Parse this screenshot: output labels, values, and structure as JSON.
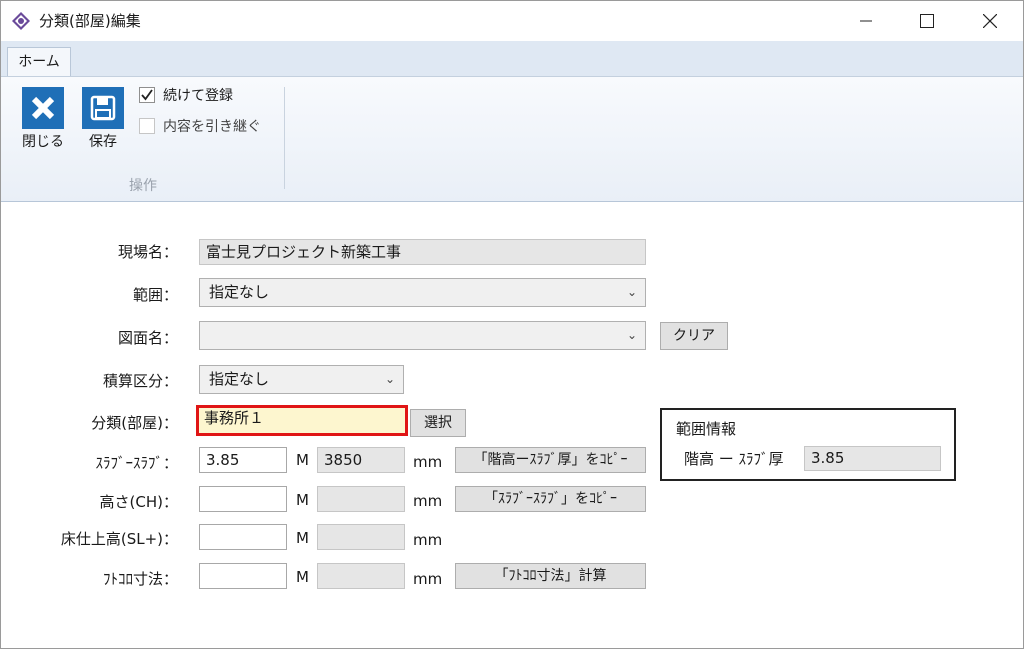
{
  "window": {
    "title": "分類(部屋)編集",
    "app_icon": "app-logo-icon",
    "controls": [
      "minimize-icon",
      "maximize-icon",
      "close-icon"
    ]
  },
  "ribbon": {
    "tabs": [
      {
        "label": "ホーム",
        "active": true
      }
    ],
    "close_label": "閉じる",
    "save_label": "保存",
    "continue_label": "続けて登録",
    "continue_checked": true,
    "inherit_label": "内容を引き継ぐ",
    "inherit_checked": false,
    "group_label": "操作"
  },
  "form": {
    "site_label": "現場名：",
    "site_value": "富士見プロジェクト新築工事",
    "range_label": "範囲：",
    "range_value": "指定なし",
    "drawing_label": "図面名：",
    "drawing_value": "",
    "clear_label": "クリア",
    "estimate_label": "積算区分：",
    "estimate_value": "指定なし",
    "category_label": "分類(部屋)：",
    "category_value": "事務所１",
    "select_label": "選択",
    "slab_label": "ｽﾗﾌﾞｰｽﾗﾌﾞ：",
    "slab_m": "3.85",
    "slab_mm": "3850",
    "slab_copy_label": "「階高ーｽﾗﾌﾞ厚」をｺﾋﾟｰ",
    "height_label": "高さ(CH)：",
    "height_m": "",
    "height_mm": "",
    "height_copy_label": "「ｽﾗﾌﾞｰｽﾗﾌﾞ」をｺﾋﾟｰ",
    "floor_label": "床仕上高(SL+)：",
    "floor_m": "",
    "floor_mm": "",
    "pocket_label": "ﾌﾄｺﾛ寸法：",
    "pocket_m": "",
    "pocket_mm": "",
    "pocket_calc_label": "「ﾌﾄｺﾛ寸法」計算",
    "unit_m": "M",
    "unit_mm": "mm"
  },
  "range_info": {
    "title": "範囲情報",
    "label": "階高 ー ｽﾗﾌﾞ厚",
    "value": "3.85"
  },
  "colors": {
    "ribbon_icon_bg": "#1f6fb7",
    "highlight_border": "#e01515",
    "highlight_bg": "#fdf6cf"
  }
}
